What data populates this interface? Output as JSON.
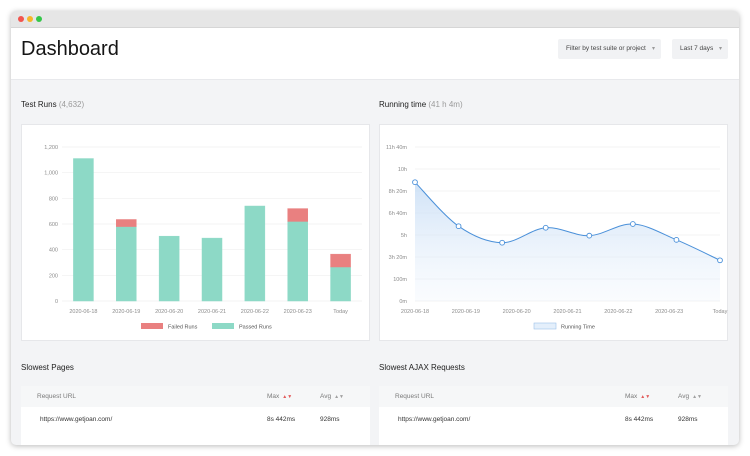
{
  "window": {
    "controls": [
      "close",
      "minimize",
      "maximize"
    ]
  },
  "header": {
    "title": "Dashboard",
    "filter_suite_label": "Filter by test suite or project",
    "filter_date_label": "Last 7 days",
    "chevron_icon": "chevron-down-icon"
  },
  "test_runs": {
    "title": "Test Runs",
    "count": "(4,632)",
    "chart_data": {
      "type": "bar",
      "stacked": true,
      "categories": [
        "2020-06-18",
        "2020-06-19",
        "2020-06-20",
        "2020-06-21",
        "2020-06-22",
        "2020-06-23",
        "Today"
      ],
      "series": [
        {
          "name": "Passed Runs",
          "color": "#8dd9c6",
          "values": [
            1110,
            580,
            505,
            490,
            740,
            620,
            265
          ]
        },
        {
          "name": "Failed Runs",
          "color": "#e98080",
          "values": [
            0,
            55,
            0,
            0,
            0,
            100,
            100
          ]
        }
      ],
      "yticks": [
        "0",
        "200",
        "400",
        "600",
        "800",
        "1,000",
        "1,200"
      ],
      "ylim": [
        0,
        1200
      ],
      "grid": true,
      "legend": "bottom"
    }
  },
  "running_time": {
    "title": "Running time",
    "total": "(41 h 4m)",
    "chart_data": {
      "type": "area",
      "categories": [
        "2020-06-18",
        "2020-06-19",
        "2020-06-20",
        "2020-06-21",
        "2020-06-22",
        "2020-06-23",
        "Today"
      ],
      "series": [
        {
          "name": "Running Time",
          "color": "#4a90d9",
          "values_minutes": [
            540,
            340,
            265,
            333,
            297,
            350,
            278,
            185
          ]
        }
      ],
      "yticks": [
        "0m",
        "100m",
        "3h 20m",
        "5h",
        "6h 40m",
        "8h 20m",
        "10h",
        "11h 40m"
      ],
      "ylim_minutes": [
        0,
        700
      ],
      "grid": true,
      "legend": "bottom"
    }
  },
  "slowest_pages": {
    "title": "Slowest Pages",
    "columns": [
      "Request URL",
      "Max",
      "Avg"
    ],
    "rows": [
      {
        "url": "https://www.getjoan.com/",
        "max": "8s 442ms",
        "avg": "928ms"
      }
    ]
  },
  "slowest_ajax": {
    "title": "Slowest AJAX  Requests",
    "columns": [
      "Request URL",
      "Max",
      "Avg"
    ],
    "rows": [
      {
        "url": "https://www.getjoan.com/",
        "max": "8s 442ms",
        "avg": "928ms"
      }
    ]
  },
  "icons": {
    "sort_active": "sort-desc-icon",
    "sort_idle": "sort-icon"
  },
  "colors": {
    "passed": "#8dd9c6",
    "failed": "#e98080",
    "line": "#4a90d9"
  }
}
